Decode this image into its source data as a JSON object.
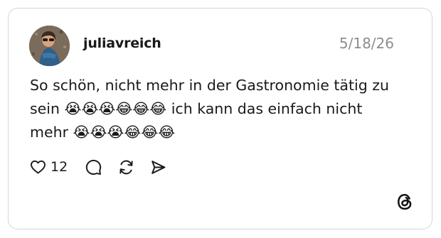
{
  "post": {
    "username": "juliavreich",
    "date": "5/18/26",
    "text": "So schön, nicht mehr in der Gastronomie tätig zu sein 😭😭😭😂😂😂 ich kann das einfach nicht mehr 😭😭😭😂😂😂",
    "likes": "12",
    "avatar_icon": "profile-photo",
    "brand_icon": "threads-logo-icon"
  },
  "icons": {
    "like": "heart-icon",
    "reply": "comment-bubble-icon",
    "repost": "repost-arrows-icon",
    "share": "send-paper-plane-icon"
  },
  "colors": {
    "text": "#1a1a1a",
    "muted": "#8e8e8e",
    "border": "#d6d6d6",
    "background": "#ffffff"
  }
}
